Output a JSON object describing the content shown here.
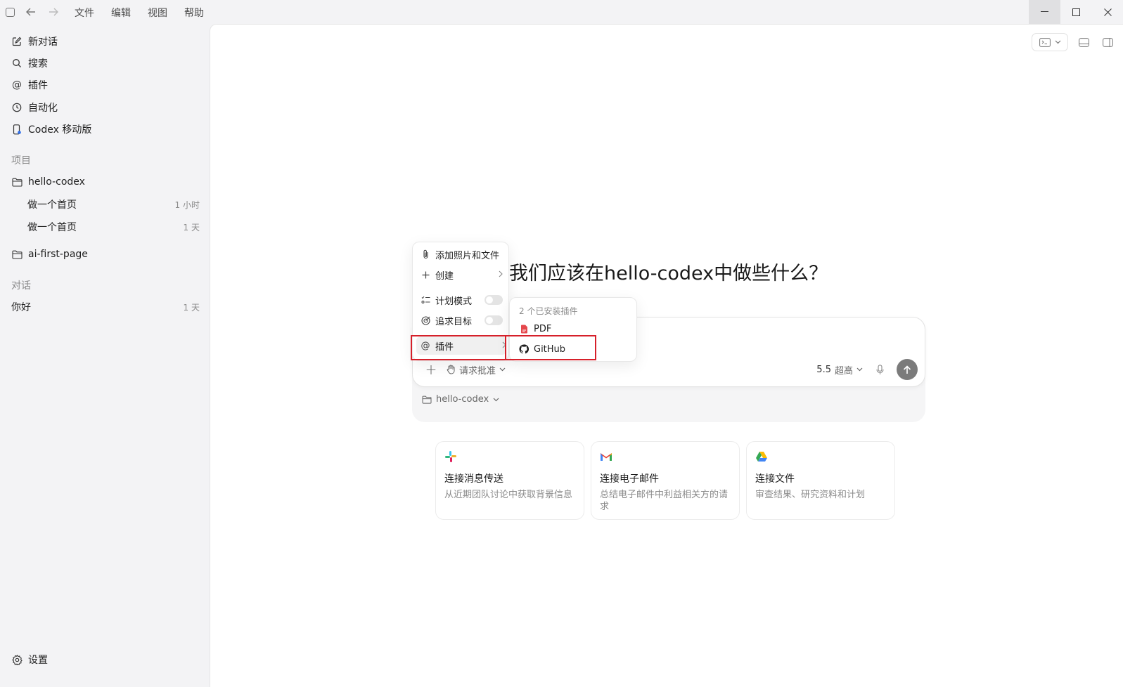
{
  "menubar": {
    "items": [
      "文件",
      "编辑",
      "视图",
      "帮助"
    ]
  },
  "sidebar": {
    "nav": [
      {
        "label": "新对话",
        "icon": "edit-icon"
      },
      {
        "label": "搜索",
        "icon": "search-icon"
      },
      {
        "label": "插件",
        "icon": "at-icon"
      },
      {
        "label": "自动化",
        "icon": "clock-icon"
      },
      {
        "label": "Codex 移动版",
        "icon": "phone-icon"
      }
    ],
    "projects_label": "项目",
    "projects": [
      {
        "name": "hello-codex",
        "threads": [
          {
            "title": "做一个首页",
            "time": "1 小时"
          },
          {
            "title": "做一个首页",
            "time": "1 天"
          }
        ]
      },
      {
        "name": "ai-first-page",
        "threads": []
      }
    ],
    "conversations_label": "对话",
    "conversations": [
      {
        "title": "你好",
        "time": "1 天"
      }
    ],
    "settings_label": "设置"
  },
  "main": {
    "headline": "我们应该在hello-codex中做些什么？",
    "composer": {
      "approval_label": "请求批准",
      "model_version": "5.5",
      "model_level": "超高",
      "project": "hello-codex"
    },
    "cards": [
      {
        "title": "连接消息传送",
        "desc": "从近期团队讨论中获取背景信息",
        "icon": "slack-icon"
      },
      {
        "title": "连接电子邮件",
        "desc": "总结电子邮件中利益相关方的请求",
        "icon": "gmail-icon"
      },
      {
        "title": "连接文件",
        "desc": "审查结果、研究资料和计划",
        "icon": "drive-icon"
      }
    ]
  },
  "popup_menu": {
    "items": [
      {
        "label": "添加照片和文件",
        "icon": "paperclip-icon"
      },
      {
        "label": "创建",
        "icon": "plus-icon"
      },
      {
        "label": "计划模式",
        "icon": "checklist-icon"
      },
      {
        "label": "追求目标",
        "icon": "target-icon"
      },
      {
        "label": "插件",
        "icon": "at-icon"
      }
    ]
  },
  "plugins_submenu": {
    "header": "2 个已安装插件",
    "items": [
      {
        "label": "PDF",
        "icon": "pdf-icon"
      },
      {
        "label": "GitHub",
        "icon": "github-icon"
      }
    ]
  },
  "colors": {
    "highlight": "#d6202a",
    "send_button": "#7b7b7b",
    "pdf": "#e5484d"
  }
}
